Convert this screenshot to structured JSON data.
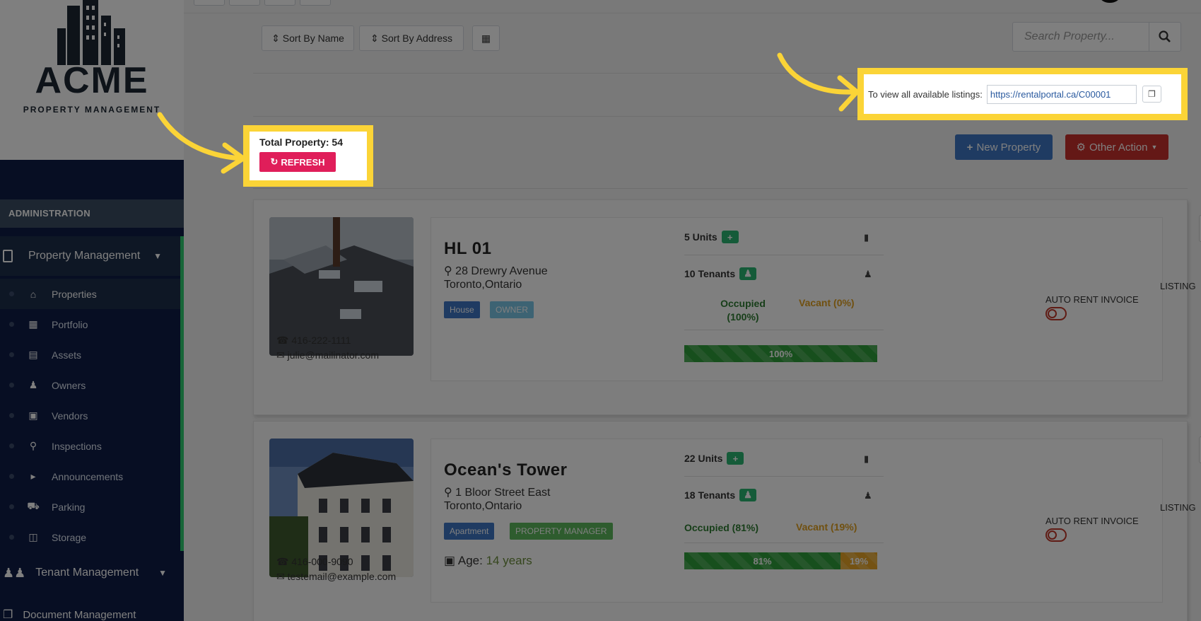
{
  "logo": {
    "name": "ACME",
    "subtitle": "PROPERTY MANAGEMENT"
  },
  "sidebar": {
    "section_title": "ADMINISTRATION",
    "main_item": "Property Management",
    "items": [
      {
        "label": "Properties",
        "icon": "home-icon"
      },
      {
        "label": "Portfolio",
        "icon": "portfolio-icon"
      },
      {
        "label": "Assets",
        "icon": "assets-icon"
      },
      {
        "label": "Owners",
        "icon": "user-icon"
      },
      {
        "label": "Vendors",
        "icon": "briefcase-icon"
      },
      {
        "label": "Inspections",
        "icon": "search-icon"
      },
      {
        "label": "Announcements",
        "icon": "megaphone-icon"
      },
      {
        "label": "Parking",
        "icon": "car-icon"
      },
      {
        "label": "Storage",
        "icon": "storage-icon"
      }
    ],
    "tenant_item": "Tenant Management",
    "document_item": "Document Management"
  },
  "toolbar": {
    "sort_name": "Sort By Name",
    "sort_address": "Sort By Address",
    "search_placeholder": "Search Property..."
  },
  "listing": {
    "label": "To view all available listings:",
    "url": "https://rentalportal.ca/C00001"
  },
  "summary": {
    "total_label": "Total Property: 54",
    "refresh_label": "REFRESH"
  },
  "actions": {
    "new_property": "New Property",
    "other_action": "Other Action"
  },
  "properties": [
    {
      "name": "HL 01",
      "address_line1": "28 Drewry Avenue",
      "address_line2": "Toronto,Ontario",
      "type_tag": "House",
      "role_tag": "OWNER",
      "units": "5 Units",
      "tenants": "10 Tenants",
      "occupied": "Occupied (100%)",
      "vacant": "Vacant (0%)",
      "occupied_pct": 100,
      "occupied_bar_label": "100%",
      "phone": "416-222-1111",
      "email": "julie@mailinator.com",
      "listing_label": "LISTING",
      "auto_rent_label": "AUTO RENT INVOICE"
    },
    {
      "name": "Ocean's Tower",
      "address_line1": "1 Bloor Street East",
      "address_line2": "Toronto,Ontario",
      "type_tag": "Apartment",
      "role_tag": "PROPERTY MANAGER",
      "age_label": "Age:",
      "age_value": "14 years",
      "units": "22 Units",
      "tenants": "18 Tenants",
      "occupied": "Occupied (81%)",
      "vacant": "Vacant (19%)",
      "occupied_pct": 81,
      "occupied_bar_label": "81%",
      "vacant_bar_label": "19%",
      "phone": "416-000-9090",
      "email": "testemail@example.com",
      "listing_label": "LISTING",
      "auto_rent_label": "AUTO RENT INVOICE"
    }
  ],
  "colors": {
    "highlight": "#fbd437",
    "sidebar": "#0f1d46",
    "refresh": "#e01e5a",
    "new_property": "#3f77c4",
    "other_action": "#c9302c",
    "occupied_bar": "#2e9e3a",
    "vacant_bar": "#e8a526"
  }
}
